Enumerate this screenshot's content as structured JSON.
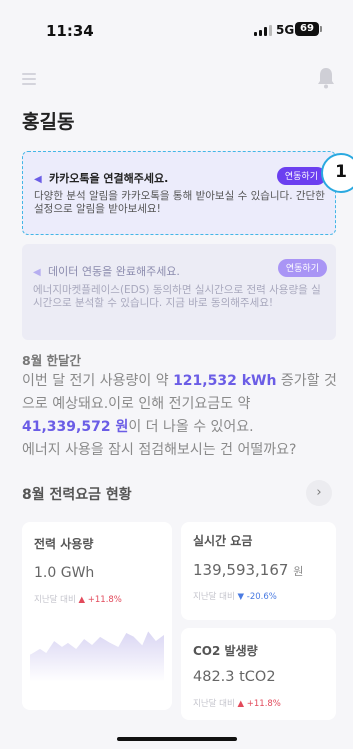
{
  "status_bar": {
    "time": "11:34",
    "network": "5G",
    "battery": "69"
  },
  "header": {
    "title": "홍길동"
  },
  "step_badge": "1",
  "notices": {
    "kakao": {
      "title": "카카오톡을 연결해주세요.",
      "description": "다양한 분석 알림을 카카오톡을 통해 받아보실 수 있습니다. 간단한 설정으로 알림을 받아보세요!",
      "button": "연동하기"
    },
    "eds": {
      "title": "데이터 연동을 완료해주세요.",
      "description": "에너지마켓플레이스(EDS) 동의하면 실시간으로 전력 사용량을 실시간으로 분석할 수 있습니다. 지금 바로 동의해주세요!",
      "button": "연동하기"
    }
  },
  "summary": {
    "heading": "8월 한달간",
    "line1_a": "이번 달 전기 사용량이 약 ",
    "usage_highlight": "121,532 kWh",
    "line1_b": " 증가할 것으로 예상돼요.이로 인해 전기요금도 약 ",
    "cost_highlight": "41,339,572 원",
    "line2": "이 더 나올 수 있어요.",
    "line3": "에너지 사용을 잠시 점검해보시는 건 어떨까요?"
  },
  "section": {
    "title": "8월 전력요금 현황",
    "more_icon": "chevron-right-icon"
  },
  "cards": {
    "usage": {
      "label": "전력 사용량",
      "value": "1.0 GWh",
      "compare_label": "지난달 대비",
      "change": "▲ +11.8%",
      "trend": "up"
    },
    "realtime": {
      "label": "실시간 요금",
      "value": "139,593,167",
      "unit": "원",
      "compare_label": "지난달 대비",
      "change": "▼ -20.6%",
      "trend": "down"
    },
    "co2": {
      "label": "CO2 발생량",
      "value": "482.3 tCO2",
      "compare_label": "지난달 대비",
      "change": "▲ +11.8%",
      "trend": "up"
    }
  },
  "colors": {
    "accent": "#6b5de6",
    "button": "#6b3ff0",
    "up": "#e24a5b",
    "down": "#4a7be2",
    "badge_border": "#2aa9e0"
  }
}
